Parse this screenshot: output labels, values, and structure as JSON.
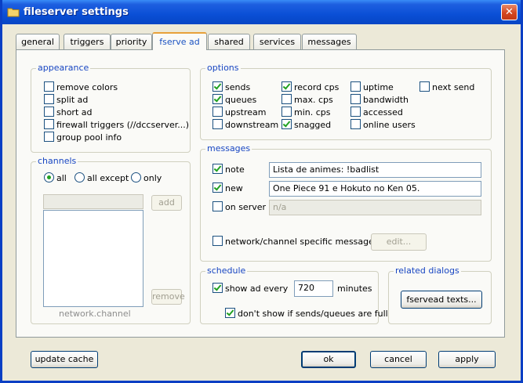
{
  "window": {
    "title": "fileserver settings",
    "close_glyph": "✕"
  },
  "tabs": [
    {
      "label": "general"
    },
    {
      "label": "triggers"
    },
    {
      "label": "priority"
    },
    {
      "label": "fserve ad"
    },
    {
      "label": "shared"
    },
    {
      "label": "services"
    },
    {
      "label": "messages"
    }
  ],
  "appearance": {
    "legend": "appearance",
    "items": [
      {
        "label": "remove colors",
        "checked": false
      },
      {
        "label": "split ad",
        "checked": false
      },
      {
        "label": "short ad",
        "checked": false
      },
      {
        "label": "firewall triggers (//dccserver...)",
        "checked": false
      },
      {
        "label": "group pool info",
        "checked": false
      }
    ]
  },
  "options": {
    "legend": "options",
    "items": [
      {
        "label": "sends",
        "checked": true
      },
      {
        "label": "queues",
        "checked": true
      },
      {
        "label": "upstream",
        "checked": false
      },
      {
        "label": "downstream",
        "checked": false
      },
      {
        "label": "record cps",
        "checked": true
      },
      {
        "label": "max. cps",
        "checked": false
      },
      {
        "label": "min. cps",
        "checked": false
      },
      {
        "label": "snagged",
        "checked": true
      },
      {
        "label": "uptime",
        "checked": false
      },
      {
        "label": "bandwidth",
        "checked": false
      },
      {
        "label": "accessed",
        "checked": false
      },
      {
        "label": "online users",
        "checked": false
      },
      {
        "label": "next send",
        "checked": false
      }
    ]
  },
  "channels": {
    "legend": "channels",
    "radios": [
      {
        "label": "all",
        "selected": true
      },
      {
        "label": "all except",
        "selected": false
      },
      {
        "label": "only",
        "selected": false
      }
    ],
    "add_label": "add",
    "remove_label": "remove",
    "list_caption": "network.channel"
  },
  "messages": {
    "legend": "messages",
    "note": {
      "label": "note",
      "checked": true,
      "value": "Lista de animes: !badlist"
    },
    "new": {
      "label": "new",
      "checked": true,
      "value": "One Piece 91 e Hokuto no Ken 05."
    },
    "on_server": {
      "label": "on server",
      "checked": false,
      "value": "n/a"
    },
    "specific": {
      "label": "network/channel specific messages",
      "checked": false
    },
    "edit_label": "edit..."
  },
  "schedule": {
    "legend": "schedule",
    "show_ad": {
      "label": "show ad every",
      "checked": true
    },
    "interval_value": "720",
    "unit": "minutes",
    "dont_show": {
      "label": "don't show if sends/queues are full",
      "checked": true
    }
  },
  "related": {
    "legend": "related dialogs",
    "button_label": "fservead texts..."
  },
  "footer": {
    "update_cache": "update cache",
    "ok": "ok",
    "cancel": "cancel",
    "apply": "apply"
  }
}
